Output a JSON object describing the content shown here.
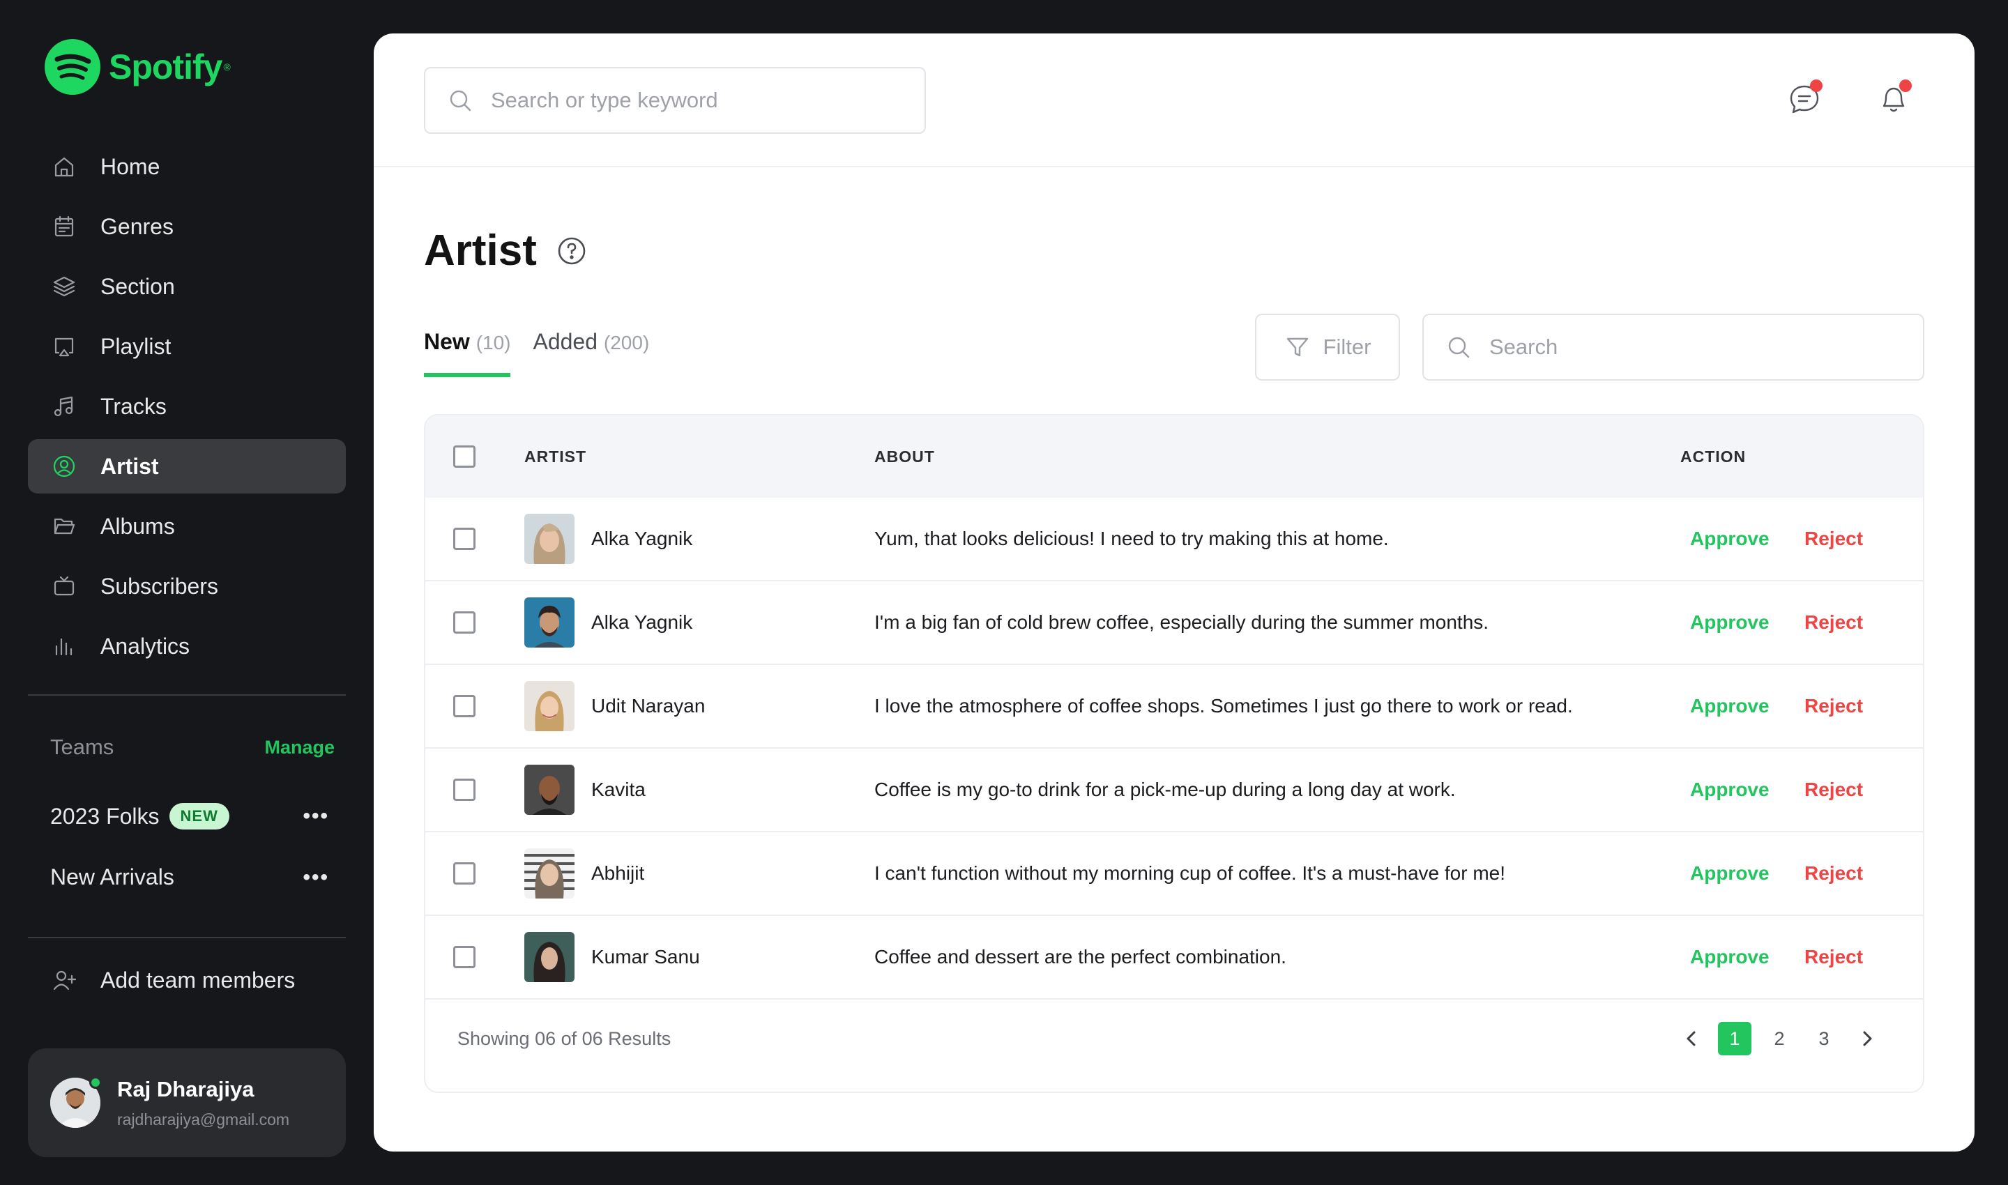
{
  "brand": {
    "name": "Spotify",
    "tm": "®",
    "color": "#1ed760"
  },
  "sidebar": {
    "items": [
      {
        "label": "Home",
        "icon": "home-icon"
      },
      {
        "label": "Genres",
        "icon": "calendar-icon"
      },
      {
        "label": "Section",
        "icon": "layers-icon"
      },
      {
        "label": "Playlist",
        "icon": "cast-icon"
      },
      {
        "label": "Tracks",
        "icon": "music-icon"
      },
      {
        "label": "Artist",
        "icon": "user-circle-icon",
        "active": true
      },
      {
        "label": "Albums",
        "icon": "folder-icon"
      },
      {
        "label": "Subscribers",
        "icon": "tv-icon"
      },
      {
        "label": "Analytics",
        "icon": "bar-chart-icon"
      }
    ],
    "teams_title": "Teams",
    "teams_manage": "Manage",
    "teams": [
      {
        "name": "2023 Folks",
        "badge": "NEW",
        "more": "•••"
      },
      {
        "name": "New Arrivals",
        "more": "•••"
      }
    ],
    "add_members": "Add team members",
    "user": {
      "name": "Raj Dharajiya",
      "email": "rajdharajiya@gmail.com",
      "status": "online"
    }
  },
  "topbar": {
    "search_placeholder": "Search or type keyword",
    "icons": [
      "chat-icon",
      "bell-icon"
    ]
  },
  "page": {
    "title": "Artist",
    "tabs": [
      {
        "label": "New",
        "count": "(10)",
        "active": true
      },
      {
        "label": "Added",
        "count": "(200)"
      }
    ],
    "filter_label": "Filter",
    "search_placeholder": "Search"
  },
  "table": {
    "headers": {
      "artist": "ARTIST",
      "about": "ABOUT",
      "action": "ACTION"
    },
    "approve_label": "Approve",
    "reject_label": "Reject",
    "rows": [
      {
        "name": "Alka Yagnik",
        "about": "Yum, that looks delicious! I need to try making this at home."
      },
      {
        "name": "Alka Yagnik",
        "about": "I'm a big fan of cold brew coffee, especially during the summer months."
      },
      {
        "name": "Udit Narayan",
        "about": "I love the atmosphere of coffee shops. Sometimes I just go there to work or read."
      },
      {
        "name": "Kavita",
        "about": "Coffee is my go-to drink for a pick-me-up during a long day at work."
      },
      {
        "name": "Abhijit",
        "about": "I can't function without my morning cup of coffee. It's a must-have for me!"
      },
      {
        "name": "Kumar Sanu",
        "about": "Coffee and dessert are the perfect combination."
      }
    ],
    "footer": "Showing 06 of 06 Results",
    "pages": [
      "1",
      "2",
      "3"
    ],
    "current_page": "1"
  },
  "colors": {
    "accent": "#22c55e",
    "danger": "#ef4444",
    "sidebar_bg": "#16171a",
    "active_bg": "#3a3b3f"
  }
}
